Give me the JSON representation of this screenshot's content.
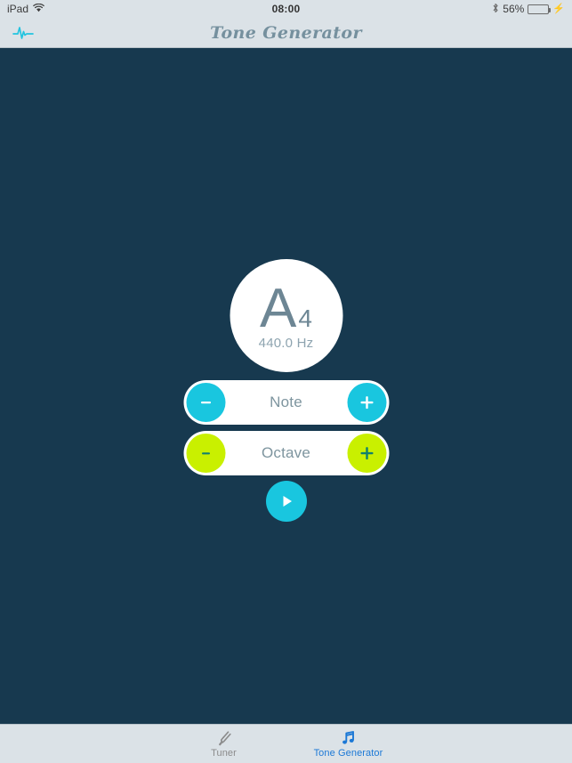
{
  "statusbar": {
    "device": "iPad",
    "wifi_icon": "wifi-icon",
    "time": "08:00",
    "bluetooth_icon": "bluetooth-icon",
    "battery_percent": "56%",
    "battery_level": 56,
    "charging_icon": "lightning-bolt-icon"
  },
  "navbar": {
    "left_icon": "waveform-pulse-icon",
    "title": "Tone Generator"
  },
  "main": {
    "note_display": {
      "note": "A",
      "octave": "4",
      "frequency": "440.0 Hz"
    },
    "steppers": [
      {
        "label": "Note",
        "decrement_label": "–",
        "increment_label": "+",
        "accent": "#19c6df",
        "glyph_color": "#ffffff"
      },
      {
        "label": "Octave",
        "decrement_label": "–",
        "increment_label": "+",
        "accent": "#c9f000",
        "glyph_color": "#12806d"
      }
    ],
    "play_button": {
      "icon": "play-triangle-icon",
      "accent": "#19c6df"
    }
  },
  "tabbar": {
    "tabs": [
      {
        "label": "Tuner",
        "icon": "tuning-fork-icon",
        "active": false
      },
      {
        "label": "Tone Generator",
        "icon": "music-note-icon",
        "active": true
      }
    ]
  },
  "colors": {
    "background": "#17394f",
    "chrome": "#dbe2e7",
    "cyan": "#19c6df",
    "lime": "#c9f000",
    "title_text": "#75909e",
    "tab_active": "#1b78d6"
  }
}
